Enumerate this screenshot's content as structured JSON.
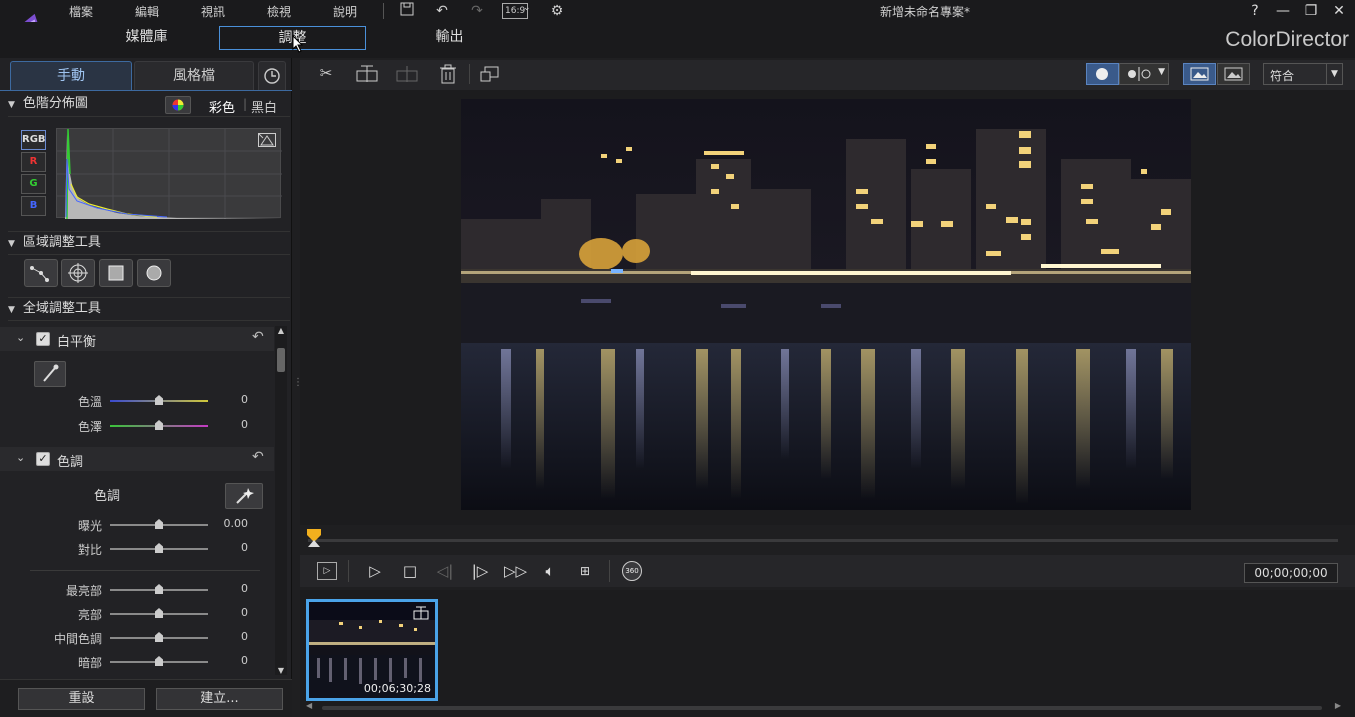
{
  "window": {
    "title": "新增未命名專案*",
    "brand": "ColorDirector",
    "help": "?",
    "minimize": "—",
    "restore": "❐",
    "close": "✕"
  },
  "menu": [
    "檔案",
    "編輯",
    "視訊",
    "檢視",
    "說明"
  ],
  "toolbar_top": {
    "aspect": "16:9"
  },
  "modes": {
    "library": "媒體庫",
    "adjust": "調整",
    "output": "輸出"
  },
  "left_tabs": {
    "manual": "手動",
    "style": "風格檔"
  },
  "histogram": {
    "title": "色階分佈圖",
    "color_label": "彩色",
    "bw_label": "黑白",
    "channels": [
      "RGB",
      "R",
      "G",
      "B"
    ]
  },
  "regional": {
    "title": "區域調整工具"
  },
  "global": {
    "title": "全域調整工具"
  },
  "white_balance": {
    "title": "白平衡",
    "sliders": [
      {
        "label": "色溫",
        "value": "0",
        "pos": 0.5
      },
      {
        "label": "色澤",
        "value": "0",
        "pos": 0.5
      }
    ]
  },
  "tone": {
    "title": "色調",
    "auto_label": "色調",
    "sliders": [
      {
        "label": "曝光",
        "value": "0.00",
        "pos": 0.5
      },
      {
        "label": "對比",
        "value": "0",
        "pos": 0.5
      },
      {
        "label": "最亮部",
        "value": "0",
        "pos": 0.5
      },
      {
        "label": "亮部",
        "value": "0",
        "pos": 0.5
      },
      {
        "label": "中間色調",
        "value": "0",
        "pos": 0.5
      },
      {
        "label": "暗部",
        "value": "0",
        "pos": 0.5
      }
    ]
  },
  "bottom_buttons": {
    "reset": "重設",
    "create": "建立..."
  },
  "view": {
    "fit": "符合"
  },
  "playback": {
    "timecode": "00;00;00;00",
    "badge_360": "360"
  },
  "clip": {
    "duration": "00;06;30;28"
  },
  "colors": {
    "accent": "#4aa3e8",
    "panel": "#222225",
    "bg": "#1f1f21"
  }
}
